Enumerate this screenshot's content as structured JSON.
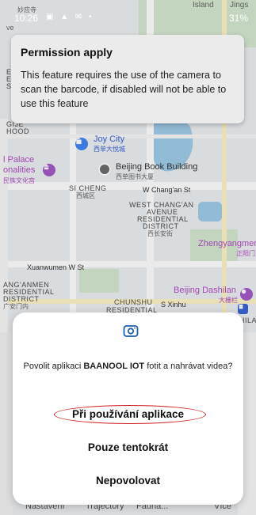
{
  "status_bar": {
    "time": "10:26",
    "icons": "▣ ▲ ✉ •",
    "right_text": "31%"
  },
  "permission_banner": {
    "title": "Permission apply",
    "message": "This feature requires the use of the camera to scan the barcode, if disabled will not be able to use this feature"
  },
  "map": {
    "labels": {
      "joy_city": "Joy City",
      "joy_city_cn": "西单大悦城",
      "palace": "l Palace",
      "nalities": "onalities",
      "palace_cn": "民族文化宫",
      "book_building": "Beijing Book Building",
      "book_building_cn": "西单图书大厦",
      "si_cheng": "SI CHENG",
      "si_cheng_cn": "西城区",
      "changan_st": "W Chang'an St",
      "changan_ave_1": "WEST CHANG'AN",
      "changan_ave_2": "AVENUE",
      "changan_ave_3": "RESIDENTIAL",
      "changan_ave_4": "DISTRICT",
      "changan_ave_cn": "西长安街",
      "zhengyangmen": "Zhengyangmen",
      "zhengyangmen_cn": "正阳门",
      "xuanwumen": "Xuanwumen W St",
      "guanganmen_1": "ANG'ANMEN",
      "guanganmen_2": "RESIDENTIAL",
      "guanganmen_3": "DISTRICT",
      "guanganmen_cn": "广安门内",
      "chunshu_1": "CHUNSHU",
      "chunshu_2": "RESIDENTIAL",
      "dashilan": "Beijing Dashilan",
      "dashilan_cn": "大栅栏",
      "dashilan_sub": "DASHILAN",
      "xinhua": "S Xinhu",
      "top_left": "妙应寺",
      "top_right": "Island",
      "top_right2": "Jings",
      "hood": "HOOD",
      "gije": "GIJE",
      "es": "ES",
      "s": "S",
      "e": "E",
      "ve": "ve"
    }
  },
  "bottom_tabs": {
    "tab1": "Nastavení",
    "tab2": "Trajectory",
    "tab3": "Fauna...",
    "tab4": "Více"
  },
  "dialog": {
    "message_prefix": "Povolit aplikaci ",
    "app_name": "BAANOOL IOT",
    "message_suffix": " fotit a nahrávat videa?",
    "option_while_using": "Při používání aplikace",
    "option_only_this_time": "Pouze tentokrát",
    "option_deny": "Nepovolovat"
  }
}
